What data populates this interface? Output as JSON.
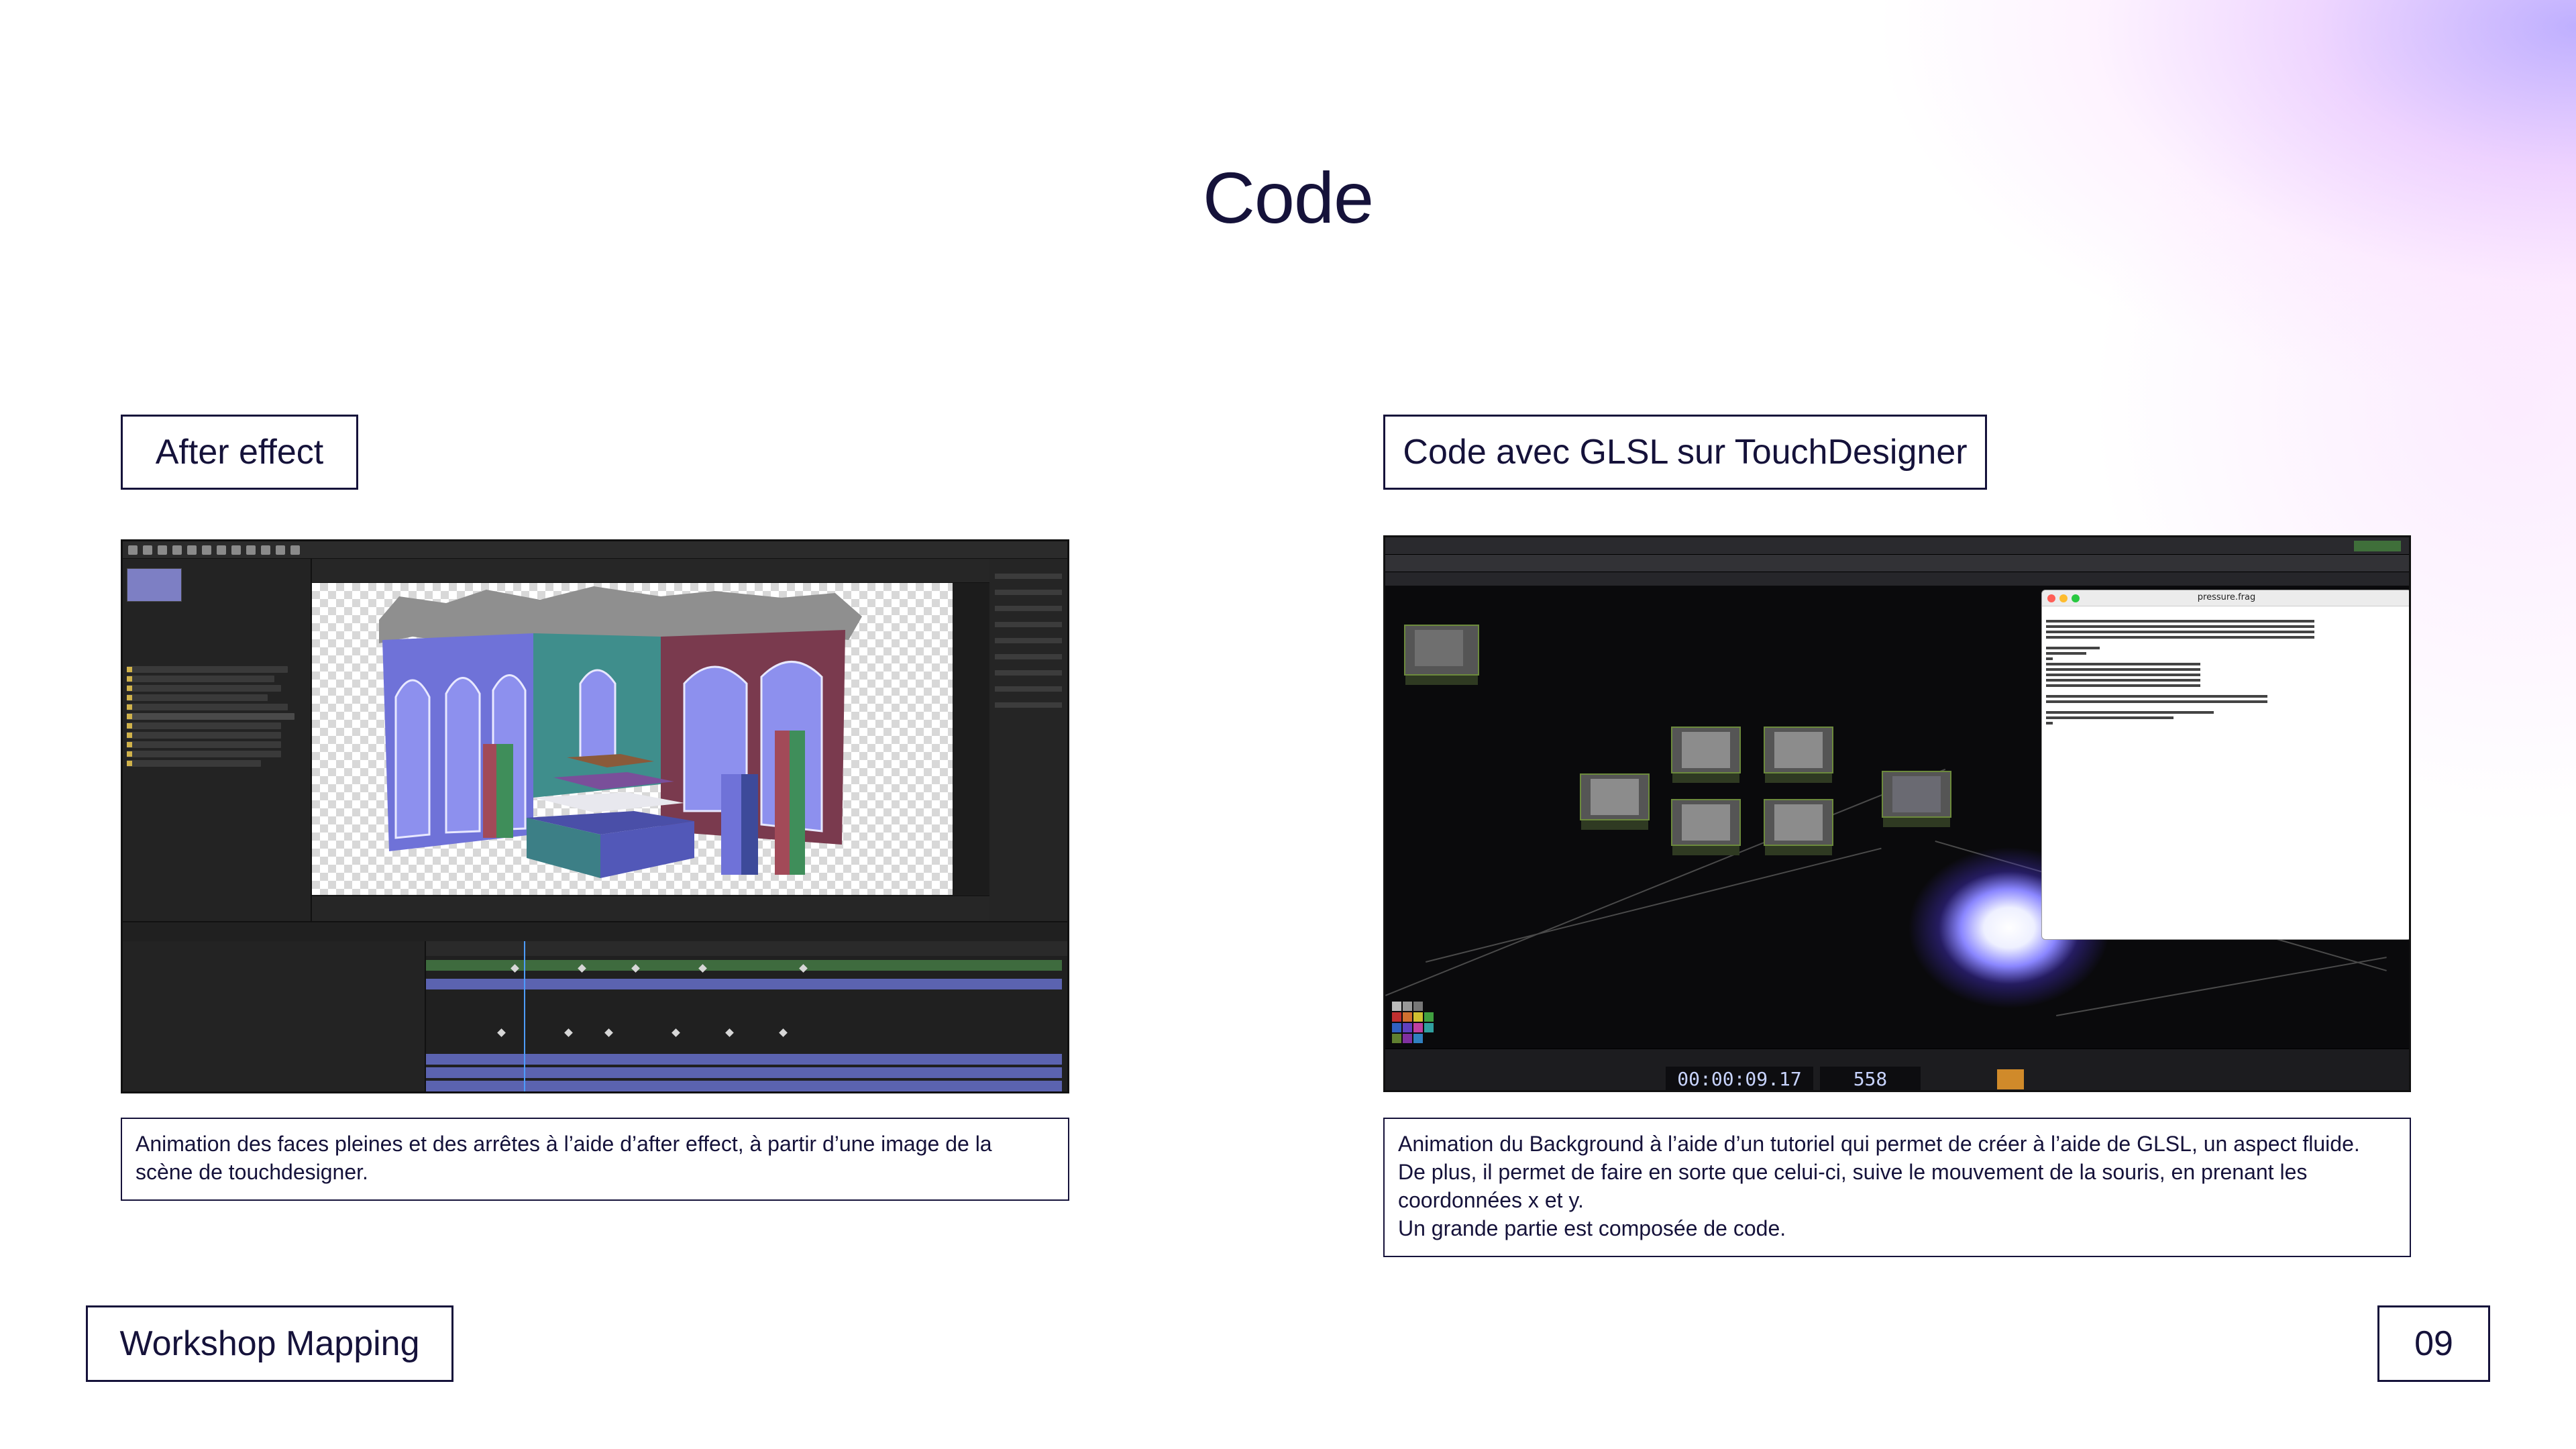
{
  "page": {
    "title": "Code",
    "number": "09",
    "footer_label": "Workshop Mapping"
  },
  "left_panel": {
    "tag": "After effect",
    "caption": "Animation des faces pleines et des arrêtes à l’aide d’after effect, à partir d’une image de la scène de touchdesigner.",
    "screenshot_icon": "after-effects-screenshot"
  },
  "right_panel": {
    "tag": "Code avec GLSL sur TouchDesigner",
    "caption_lines": [
      "Animation du Background à l’aide d’un tutoriel qui permet de créer à l’aide de GLSL,  un aspect fluide.",
      "De plus, il permet de faire en sorte que celui-ci, suive le mouvement de la souris, en prenant les",
      "coordonnées x et y.",
      "Un grande partie est composée de code."
    ],
    "screenshot_icon": "touchdesigner-screenshot",
    "code_window_title": "pressure.frag",
    "timecode": "00:00:09.17",
    "frame": "558"
  },
  "colors": {
    "text": "#15123a",
    "accent_glow": "#c7a8ff",
    "background": "#ffffff"
  }
}
